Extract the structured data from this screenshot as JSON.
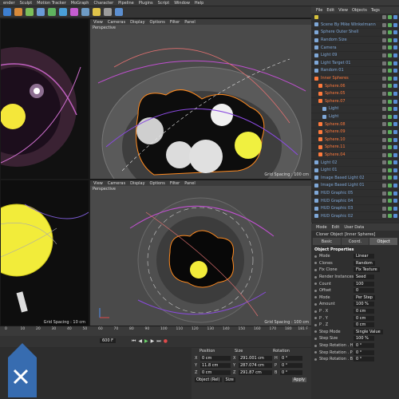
{
  "menubar": [
    "ender",
    "Sculpt",
    "Motion Tracker",
    "MoGraph",
    "Character",
    "Pipeline",
    "Plugins",
    "Script",
    "Window",
    "Help"
  ],
  "viewport_menu": [
    "View",
    "Cameras",
    "Display",
    "Options",
    "Filter",
    "Panel"
  ],
  "viewports": {
    "top_right_label": "Perspective",
    "top_right_grid": "Grid Spacing : 100 cm",
    "bottom_right_label": "Perspective",
    "bottom_left_grid": "Grid Spacing : 10 cm",
    "bottom_right_grid": "Grid Spacing : 100 cm"
  },
  "object_manager": {
    "menu": [
      "File",
      "Edit",
      "View",
      "Objects",
      "Tags"
    ],
    "rows": [
      {
        "name": "",
        "color": "#d6c23c",
        "indent": 0
      },
      {
        "name": "Scene By Mike Winkelmann",
        "color": "#7fa8d8",
        "indent": 0
      },
      {
        "name": "Sphere Outer Shell",
        "color": "#7fa8d8",
        "indent": 0
      },
      {
        "name": "Random Size",
        "color": "#7fa8d8",
        "indent": 0
      },
      {
        "name": "Camera",
        "color": "#7fa8d8",
        "indent": 0
      },
      {
        "name": "Light 09",
        "color": "#7fa8d8",
        "indent": 0
      },
      {
        "name": "Light Target 01",
        "color": "#7fa8d8",
        "indent": 0
      },
      {
        "name": "Random 01",
        "color": "#7fa8d8",
        "indent": 0
      },
      {
        "name": "Inner Spheres",
        "color": "#ff7a3c",
        "indent": 0
      },
      {
        "name": "Sphere.06",
        "color": "#ff7a3c",
        "indent": 1
      },
      {
        "name": "Sphere.05",
        "color": "#ff7a3c",
        "indent": 1
      },
      {
        "name": "Sphere.07",
        "color": "#ff7a3c",
        "indent": 1
      },
      {
        "name": "Light",
        "color": "#7fa8d8",
        "indent": 2
      },
      {
        "name": "Light",
        "color": "#7fa8d8",
        "indent": 2
      },
      {
        "name": "Sphere.08",
        "color": "#ff7a3c",
        "indent": 1
      },
      {
        "name": "Sphere.09",
        "color": "#ff7a3c",
        "indent": 1
      },
      {
        "name": "Sphere.10",
        "color": "#ff7a3c",
        "indent": 1
      },
      {
        "name": "Sphere.11",
        "color": "#ff7a3c",
        "indent": 1
      },
      {
        "name": "Sphere.04",
        "color": "#ff7a3c",
        "indent": 1
      },
      {
        "name": "Light 02",
        "color": "#7fa8d8",
        "indent": 0
      },
      {
        "name": "Light 01",
        "color": "#7fa8d8",
        "indent": 0
      },
      {
        "name": "Image Based Light 02",
        "color": "#7fa8d8",
        "indent": 0
      },
      {
        "name": "Image Based Light 01",
        "color": "#7fa8d8",
        "indent": 0
      },
      {
        "name": "HUD Graphic 05",
        "color": "#7fa8d8",
        "indent": 0
      },
      {
        "name": "HUD Graphic 04",
        "color": "#7fa8d8",
        "indent": 0
      },
      {
        "name": "HUD Graphic 03",
        "color": "#7fa8d8",
        "indent": 0
      },
      {
        "name": "HUD Graphic 02",
        "color": "#7fa8d8",
        "indent": 0
      }
    ]
  },
  "attributes": {
    "menu": [
      "Mode",
      "Edit",
      "User Data"
    ],
    "title": "Cloner Object [Inner Spheres]",
    "tabs": [
      "Basic",
      "Coord.",
      "Object"
    ],
    "section": "Object Properties",
    "props": [
      {
        "label": "Mode",
        "value": "Linear"
      },
      {
        "label": "Clones",
        "value": "Random"
      },
      {
        "label": "Fix Clone",
        "value": "Fix Texture"
      },
      {
        "label": "Render Instances",
        "value": "Seed"
      },
      {
        "label": "Count",
        "value": "100"
      },
      {
        "label": "Offset",
        "value": "0"
      },
      {
        "label": "Mode",
        "value": "Per Step"
      },
      {
        "label": "Amount",
        "value": "100 %"
      },
      {
        "label": "P . X",
        "value": "0 cm"
      },
      {
        "label": "P . Y",
        "value": "0 cm"
      },
      {
        "label": "P . Z",
        "value": "0 cm"
      },
      {
        "label": "Step Mode",
        "value": "Single Value"
      },
      {
        "label": "Step Size",
        "value": "100 %"
      },
      {
        "label": "Step Rotation . H",
        "value": "0 °"
      },
      {
        "label": "Step Rotation . P",
        "value": "0 °"
      },
      {
        "label": "Step Rotation . B",
        "value": "0 °"
      }
    ]
  },
  "timeline": {
    "ticks": [
      "0",
      "10",
      "20",
      "30",
      "40",
      "50",
      "60",
      "70",
      "80",
      "90",
      "100",
      "110",
      "120",
      "130",
      "140",
      "150",
      "160",
      "170",
      "180"
    ],
    "end_frame": "181 F",
    "current": "600 F"
  },
  "coordinates": {
    "headers": [
      "Position",
      "Size",
      "Rotation"
    ],
    "rows": [
      {
        "axis": "X",
        "pos": "0 cm",
        "size": "291.001 cm",
        "rot_axis": "H",
        "rot": "0 °"
      },
      {
        "axis": "Y",
        "pos": "11.8 cm",
        "size": "287.074 cm",
        "rot_axis": "P",
        "rot": "0 °"
      },
      {
        "axis": "Z",
        "pos": "0 cm",
        "size": "291.87 cm",
        "rot_axis": "B",
        "rot": "0 °"
      }
    ],
    "mode": "Object (Rel)",
    "size_mode": "Size",
    "apply": "Apply"
  }
}
